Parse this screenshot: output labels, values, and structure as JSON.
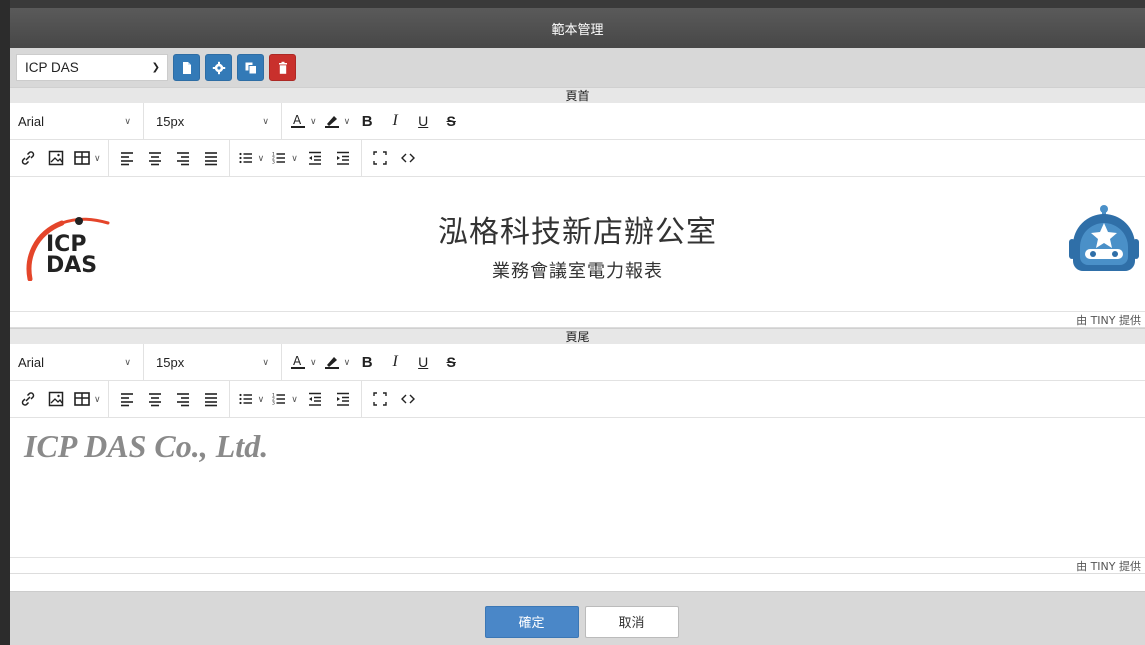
{
  "dialog": {
    "title": "範本管理",
    "template_select": "ICP DAS"
  },
  "header_section": {
    "label": "頁首",
    "font_family": "Arial",
    "font_size": "15px",
    "content": {
      "title": "泓格科技新店辦公室",
      "subtitle": "業務會議室電力報表",
      "logo_top": "ICP",
      "logo_bottom": "DAS"
    },
    "status": "由 TINY 提供"
  },
  "footer_section": {
    "label": "頁尾",
    "font_family": "Arial",
    "font_size": "15px",
    "content": {
      "text": "ICP DAS Co., Ltd."
    },
    "status": "由 TINY 提供"
  },
  "buttons": {
    "confirm": "確定",
    "cancel": "取消"
  },
  "colors": {
    "primary": "#4a87c8",
    "danger": "#c9302c",
    "accent_blue": "#337ab7",
    "logo_red": "#e4452a"
  }
}
